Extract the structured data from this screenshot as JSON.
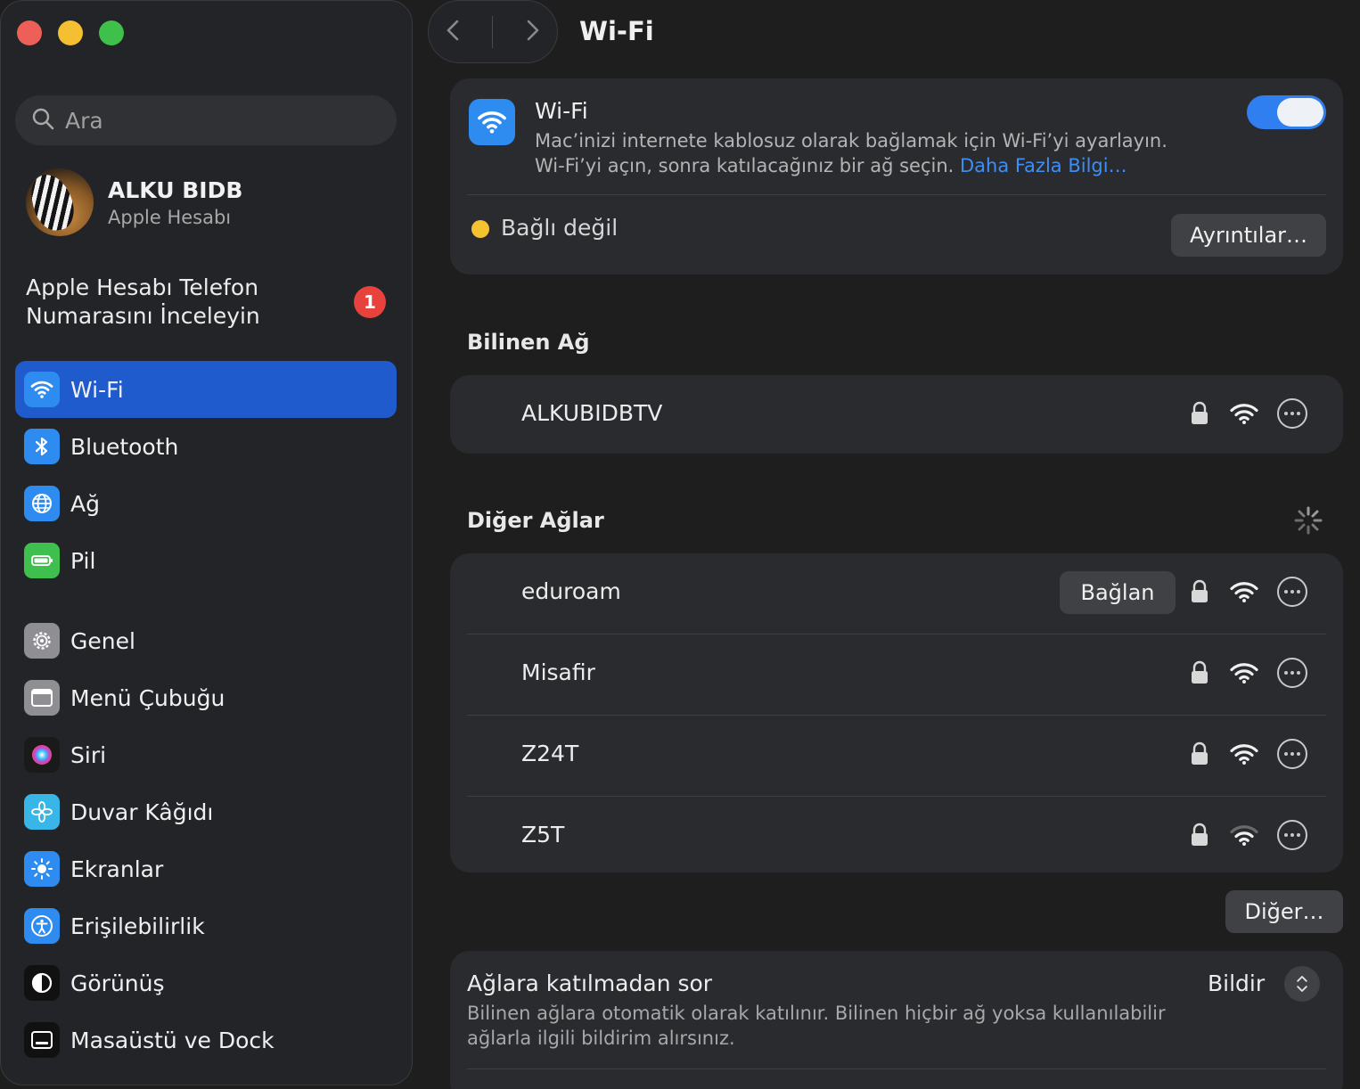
{
  "window": {
    "title": "Wi-Fi"
  },
  "search": {
    "placeholder": "Ara"
  },
  "account": {
    "name": "ALKU BIDB",
    "subtitle": "Apple Hesabı"
  },
  "notice": {
    "text": "Apple Hesabı Telefon Numarasını İnceleyin",
    "badge": "1"
  },
  "sidebar": {
    "items": [
      {
        "label": "Wi-Fi",
        "icon": "wifi-icon",
        "color": "#2e8bf0",
        "active": true
      },
      {
        "label": "Bluetooth",
        "icon": "bluetooth-icon",
        "color": "#2e8bf0"
      },
      {
        "label": "Ağ",
        "icon": "globe-icon",
        "color": "#2e8bf0"
      },
      {
        "label": "Pil",
        "icon": "battery-icon",
        "color": "#3fbf4d"
      },
      {
        "label": "Genel",
        "icon": "gear-icon",
        "color": "#8e8e93"
      },
      {
        "label": "Menü Çubuğu",
        "icon": "menubar-icon",
        "color": "#8e8e93"
      },
      {
        "label": "Siri",
        "icon": "siri-icon",
        "color": "#7a4de0"
      },
      {
        "label": "Duvar Kâğıdı",
        "icon": "wallpaper-icon",
        "color": "#38b6e8"
      },
      {
        "label": "Ekranlar",
        "icon": "display-icon",
        "color": "#2e8bf0"
      },
      {
        "label": "Erişilebilirlik",
        "icon": "accessibility-icon",
        "color": "#2e8bf0"
      },
      {
        "label": "Görünüş",
        "icon": "appearance-icon",
        "color": "#111111"
      },
      {
        "label": "Masaüstü ve Dock",
        "icon": "dock-icon",
        "color": "#111111"
      }
    ]
  },
  "wifi": {
    "title": "Wi-Fi",
    "description_line1": "Mac’inizi internete kablosuz olarak bağlamak için Wi-Fi’yi ayarlayın.",
    "description_line2": "Wi-Fi’yi açın, sonra katılacağınız bir ağ seçin.",
    "learn_more": "Daha Fazla Bilgi…",
    "enabled": true,
    "status": "Bağlı değil",
    "status_color": "#f5c331",
    "details_button": "Ayrıntılar…"
  },
  "known": {
    "heading": "Bilinen Ağ",
    "networks": [
      {
        "name": "ALKUBIDBTV",
        "locked": true
      }
    ]
  },
  "other": {
    "heading": "Diğer Ağlar",
    "connect_button": "Bağlan",
    "networks": [
      {
        "name": "eduroam",
        "locked": true
      },
      {
        "name": "Misafir",
        "locked": true
      },
      {
        "name": "Z24T",
        "locked": true
      },
      {
        "name": "Z5T",
        "locked": true
      }
    ],
    "other_button": "Diğer…"
  },
  "ask": {
    "title": "Ağlara katılmadan sor",
    "description": "Bilinen ağlara otomatik olarak katılınır. Bilinen hiçbir ağ yoksa kullanılabilir ağlarla ilgili bildirim alırsınız.",
    "value": "Bildir"
  }
}
